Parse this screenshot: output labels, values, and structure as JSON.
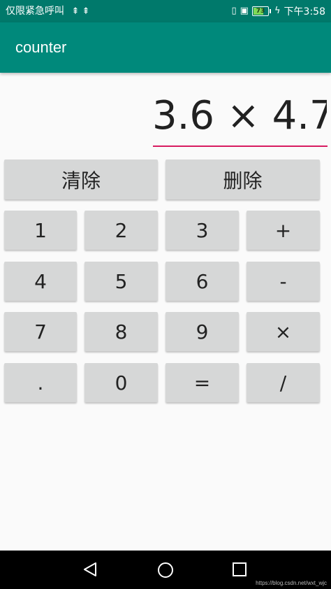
{
  "status_bar": {
    "left_text": "仅限紧急呼叫",
    "usb_icons": "⇞ ⇞",
    "battery_level": 73,
    "battery_text": "73",
    "time": "下午3:58"
  },
  "app": {
    "title": "counter"
  },
  "display": {
    "expression": "3.6 × 4.7"
  },
  "buttons": {
    "clear": "清除",
    "delete": "删除",
    "k1": "1",
    "k2": "2",
    "k3": "3",
    "plus": "+",
    "k4": "4",
    "k5": "5",
    "k6": "6",
    "minus": "-",
    "k7": "7",
    "k8": "8",
    "k9": "9",
    "multiply": "×",
    "dot": ".",
    "k0": "0",
    "equals": "=",
    "divide": "/"
  },
  "watermark": "https://blog.csdn.net/wxt_wjc",
  "colors": {
    "status_bar": "#00796b",
    "app_bar": "#00897b",
    "accent_underline": "#d81b60",
    "button": "#d6d7d7",
    "background": "#fafafa"
  }
}
